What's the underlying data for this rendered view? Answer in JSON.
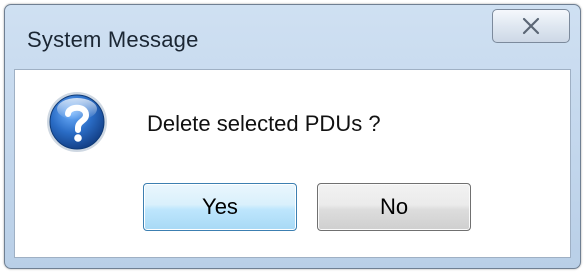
{
  "dialog": {
    "title": "System Message",
    "close_icon": "close-icon",
    "message": "Delete selected PDUs ?",
    "message_icon": "question-icon",
    "buttons": {
      "yes_label": "Yes",
      "no_label": "No"
    }
  },
  "colors": {
    "frame": "#c2d6ec",
    "icon_blue": "#1f5fae",
    "default_button": "#bee6fd"
  }
}
